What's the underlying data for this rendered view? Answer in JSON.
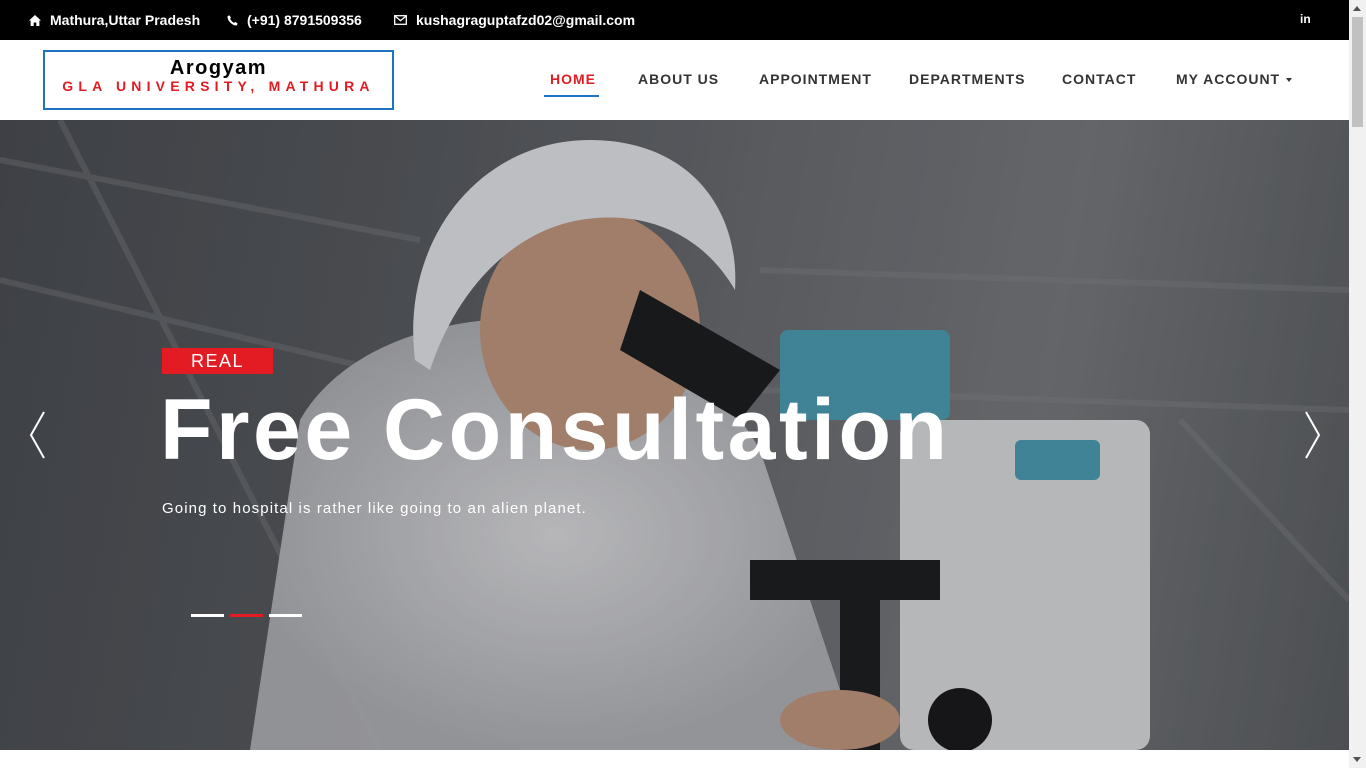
{
  "topbar": {
    "address": "Mathura,Uttar Pradesh",
    "phone": "(+91) 8791509356",
    "email": "kushagraguptafzd02@gmail.com",
    "social_linkedin": "in"
  },
  "logo": {
    "line1": "Arogyam",
    "line2": "GLA UNIVERSITY, MATHURA"
  },
  "nav": {
    "items": [
      {
        "label": "HOME",
        "active": true
      },
      {
        "label": "ABOUT US"
      },
      {
        "label": "APPOINTMENT"
      },
      {
        "label": "DEPARTMENTS"
      },
      {
        "label": "CONTACT"
      },
      {
        "label": "MY ACCOUNT"
      }
    ]
  },
  "hero": {
    "tag": "REAL",
    "title": "Free Consultation",
    "subtitle": "Going to hospital is rather like going to an alien planet.",
    "slides": 3,
    "active_slide": 2
  },
  "colors": {
    "accent_red": "#e31b23",
    "accent_blue": "#1e73be",
    "topbar_bg": "#000000"
  }
}
